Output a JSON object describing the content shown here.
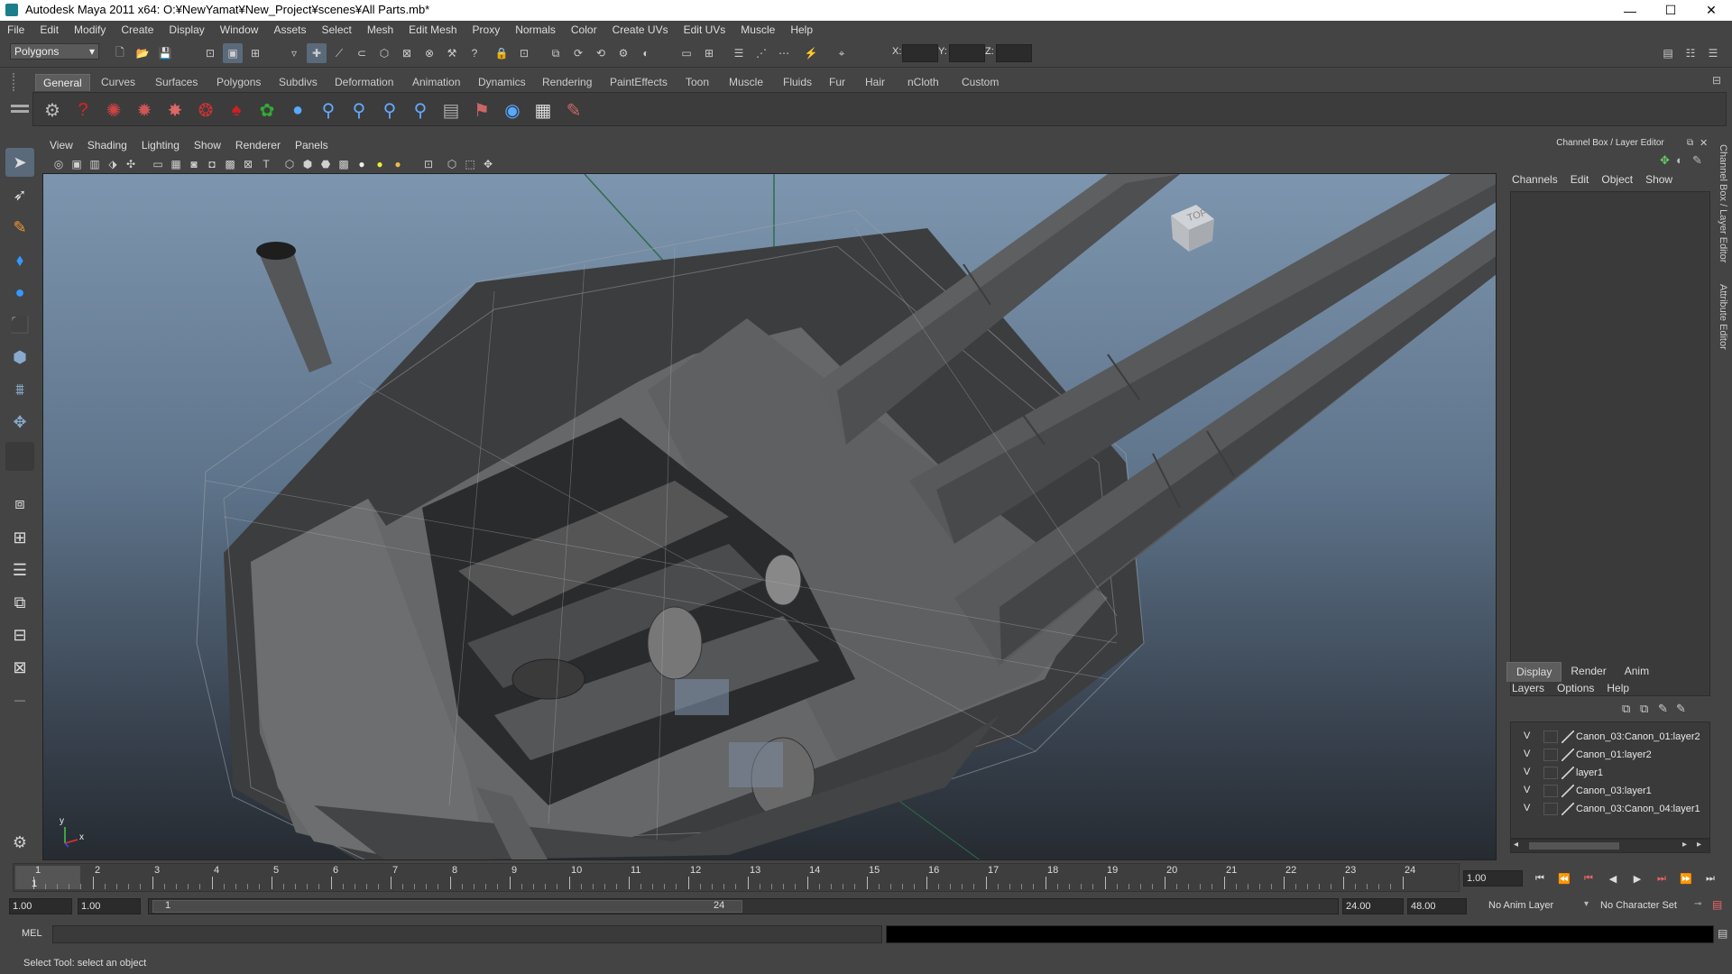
{
  "window": {
    "title": "Autodesk Maya 2011 x64: O:¥NewYamat¥New_Project¥scenes¥All Parts.mb*",
    "minimize": "—",
    "maximize": "☐",
    "close": "✕"
  },
  "menubar": [
    "File",
    "Edit",
    "Modify",
    "Create",
    "Display",
    "Window",
    "Assets",
    "Select",
    "Mesh",
    "Edit Mesh",
    "Proxy",
    "Normals",
    "Color",
    "Create UVs",
    "Edit UVs",
    "Muscle",
    "Help"
  ],
  "statusline": {
    "mode": "Polygons",
    "x_label": "X:",
    "y_label": "Y:",
    "z_label": "Z:"
  },
  "shelf_tabs": [
    "General",
    "Curves",
    "Surfaces",
    "Polygons",
    "Subdivs",
    "Deformation",
    "Animation",
    "Dynamics",
    "Rendering",
    "PaintEffects",
    "Toon",
    "Muscle",
    "Fluids",
    "Fur",
    "Hair",
    "nCloth",
    "Custom"
  ],
  "shelf_active": "General",
  "panel_menu": [
    "View",
    "Shading",
    "Lighting",
    "Show",
    "Renderer",
    "Panels"
  ],
  "viewcube_label": "TOP",
  "axis": {
    "x": "x",
    "y": "y"
  },
  "right_panel": {
    "title": "Channel Box / Layer Editor",
    "menu": [
      "Channels",
      "Edit",
      "Object",
      "Show"
    ],
    "layer_tabs": [
      "Display",
      "Render",
      "Anim"
    ],
    "layer_tab_active": "Display",
    "layer_menu": [
      "Layers",
      "Options",
      "Help"
    ],
    "layers": [
      {
        "vis": "V",
        "name": "Canon_03:Canon_01:layer2"
      },
      {
        "vis": "V",
        "name": "Canon_01:layer2"
      },
      {
        "vis": "V",
        "name": "layer1"
      },
      {
        "vis": "V",
        "name": "Canon_03:layer1"
      },
      {
        "vis": "V",
        "name": "Canon_03:Canon_04:layer1"
      }
    ]
  },
  "side_tabs": [
    "Channel Box / Layer Editor",
    "Attribute Editor"
  ],
  "timeline": {
    "ticks": [
      "1",
      "2",
      "3",
      "4",
      "5",
      "6",
      "7",
      "8",
      "9",
      "10",
      "11",
      "12",
      "13",
      "14",
      "15",
      "16",
      "17",
      "18",
      "19",
      "20",
      "21",
      "22",
      "23",
      "24"
    ],
    "current_frame": "1",
    "current_field": "1.00"
  },
  "range": {
    "start": "1.00",
    "playback_start": "1.00",
    "slider_start": "1",
    "slider_end": "24",
    "playback_end": "24.00",
    "end": "48.00",
    "anim_layer": "No Anim Layer",
    "char_set": "No Character Set"
  },
  "cmdline": {
    "label": "MEL"
  },
  "helpline": {
    "text": "Select Tool: select an object"
  }
}
